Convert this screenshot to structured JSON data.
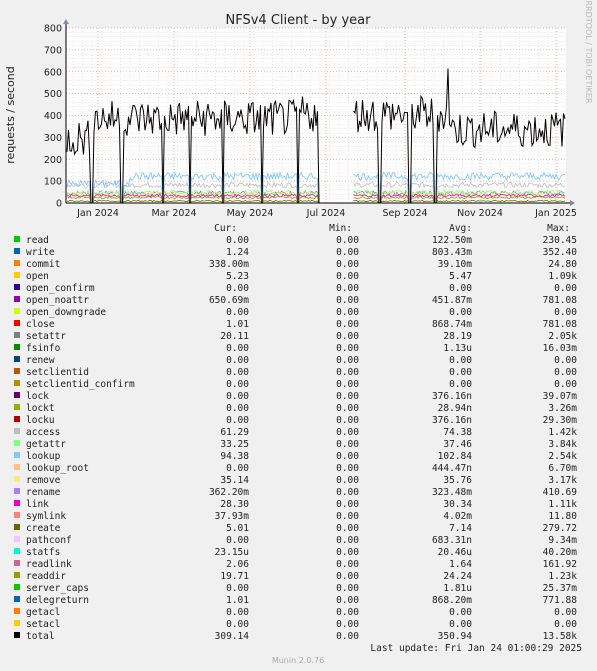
{
  "chart_data": {
    "type": "line",
    "title": "NFSv4 Client - by year",
    "ylabel": "requests / second",
    "ylim": [
      0,
      800
    ],
    "yticks": [
      0,
      100,
      200,
      300,
      400,
      500,
      600,
      700,
      800
    ],
    "xticks": [
      "Jan 2024",
      "Mar 2024",
      "May 2024",
      "Jul 2024",
      "Sep 2024",
      "Nov 2024",
      "Jan 2025"
    ],
    "grid": true,
    "sidebar_text": "RRDTOOL / TOBI OETIKER",
    "columns": [
      "Cur:",
      "Min:",
      "Avg:",
      "Max:"
    ],
    "series": [
      {
        "name": "read",
        "color": "#00cc00",
        "cur": "0.00",
        "min": "0.00",
        "avg": "122.50m",
        "max": "230.45"
      },
      {
        "name": "write",
        "color": "#0066b3",
        "cur": "1.24",
        "min": "0.00",
        "avg": "803.43m",
        "max": "352.40"
      },
      {
        "name": "commit",
        "color": "#ff8000",
        "cur": "338.00m",
        "min": "0.00",
        "avg": "39.10m",
        "max": "24.80"
      },
      {
        "name": "open",
        "color": "#ffcc00",
        "cur": "5.23",
        "min": "0.00",
        "avg": "5.47",
        "max": "1.09k"
      },
      {
        "name": "open_confirm",
        "color": "#330099",
        "cur": "0.00",
        "min": "0.00",
        "avg": "0.00",
        "max": "0.00"
      },
      {
        "name": "open_noattr",
        "color": "#990099",
        "cur": "650.69m",
        "min": "0.00",
        "avg": "451.87m",
        "max": "781.08"
      },
      {
        "name": "open_downgrade",
        "color": "#ccff00",
        "cur": "0.00",
        "min": "0.00",
        "avg": "0.00",
        "max": "0.00"
      },
      {
        "name": "close",
        "color": "#ff0000",
        "cur": "1.01",
        "min": "0.00",
        "avg": "868.74m",
        "max": "781.08"
      },
      {
        "name": "setattr",
        "color": "#808080",
        "cur": "20.11",
        "min": "0.00",
        "avg": "28.19",
        "max": "2.05k"
      },
      {
        "name": "fsinfo",
        "color": "#008f00",
        "cur": "0.00",
        "min": "0.00",
        "avg": "1.13u",
        "max": "16.03m"
      },
      {
        "name": "renew",
        "color": "#00487d",
        "cur": "0.00",
        "min": "0.00",
        "avg": "0.00",
        "max": "0.00"
      },
      {
        "name": "setclientid",
        "color": "#b35a00",
        "cur": "0.00",
        "min": "0.00",
        "avg": "0.00",
        "max": "0.00"
      },
      {
        "name": "setclientid_confirm",
        "color": "#b38f00",
        "cur": "0.00",
        "min": "0.00",
        "avg": "0.00",
        "max": "0.00"
      },
      {
        "name": "lock",
        "color": "#6b006b",
        "cur": "0.00",
        "min": "0.00",
        "avg": "376.16n",
        "max": "39.07m"
      },
      {
        "name": "lockt",
        "color": "#8fb300",
        "cur": "0.00",
        "min": "0.00",
        "avg": "28.94n",
        "max": "3.26m"
      },
      {
        "name": "locku",
        "color": "#b30000",
        "cur": "0.00",
        "min": "0.00",
        "avg": "376.16n",
        "max": "29.30m"
      },
      {
        "name": "access",
        "color": "#bebebe",
        "cur": "61.29",
        "min": "0.00",
        "avg": "74.38",
        "max": "1.42k"
      },
      {
        "name": "getattr",
        "color": "#80ff80",
        "cur": "33.25",
        "min": "0.00",
        "avg": "37.46",
        "max": "3.84k"
      },
      {
        "name": "lookup",
        "color": "#80c9ff",
        "cur": "94.38",
        "min": "0.00",
        "avg": "102.84",
        "max": "2.54k"
      },
      {
        "name": "lookup_root",
        "color": "#ffc080",
        "cur": "0.00",
        "min": "0.00",
        "avg": "444.47n",
        "max": "6.70m"
      },
      {
        "name": "remove",
        "color": "#ffe680",
        "cur": "35.14",
        "min": "0.00",
        "avg": "35.76",
        "max": "3.17k"
      },
      {
        "name": "rename",
        "color": "#aa80ff",
        "cur": "362.20m",
        "min": "0.00",
        "avg": "323.48m",
        "max": "410.69"
      },
      {
        "name": "link",
        "color": "#ee00cc",
        "cur": "28.30",
        "min": "0.00",
        "avg": "30.34",
        "max": "1.11k"
      },
      {
        "name": "symlink",
        "color": "#ff8080",
        "cur": "37.93m",
        "min": "0.00",
        "avg": "4.02m",
        "max": "11.80"
      },
      {
        "name": "create",
        "color": "#666600",
        "cur": "5.01",
        "min": "0.00",
        "avg": "7.14",
        "max": "279.72"
      },
      {
        "name": "pathconf",
        "color": "#ffbfff",
        "cur": "0.00",
        "min": "0.00",
        "avg": "683.31n",
        "max": "9.34m"
      },
      {
        "name": "statfs",
        "color": "#00ffcc",
        "cur": "23.15u",
        "min": "0.00",
        "avg": "20.46u",
        "max": "40.20m"
      },
      {
        "name": "readlink",
        "color": "#cc6699",
        "cur": "2.06",
        "min": "0.00",
        "avg": "1.64",
        "max": "161.92"
      },
      {
        "name": "readdir",
        "color": "#999900",
        "cur": "19.71",
        "min": "0.00",
        "avg": "24.24",
        "max": "1.23k"
      },
      {
        "name": "server_caps",
        "color": "#00cc00",
        "cur": "0.00",
        "min": "0.00",
        "avg": "1.81u",
        "max": "25.37m"
      },
      {
        "name": "delegreturn",
        "color": "#0066b3",
        "cur": "1.01",
        "min": "0.00",
        "avg": "868.20m",
        "max": "771.88"
      },
      {
        "name": "getacl",
        "color": "#ff8000",
        "cur": "0.00",
        "min": "0.00",
        "avg": "0.00",
        "max": "0.00"
      },
      {
        "name": "setacl",
        "color": "#ffcc00",
        "cur": "0.00",
        "min": "0.00",
        "avg": "0.00",
        "max": "0.00"
      },
      {
        "name": "total",
        "color": "#000000",
        "cur": "309.14",
        "min": "0.00",
        "avg": "350.94",
        "max": "13.58k"
      }
    ],
    "last_update": "Last update: Fri Jan 24 01:00:29 2025",
    "footer": "Munin 2.0.76"
  }
}
